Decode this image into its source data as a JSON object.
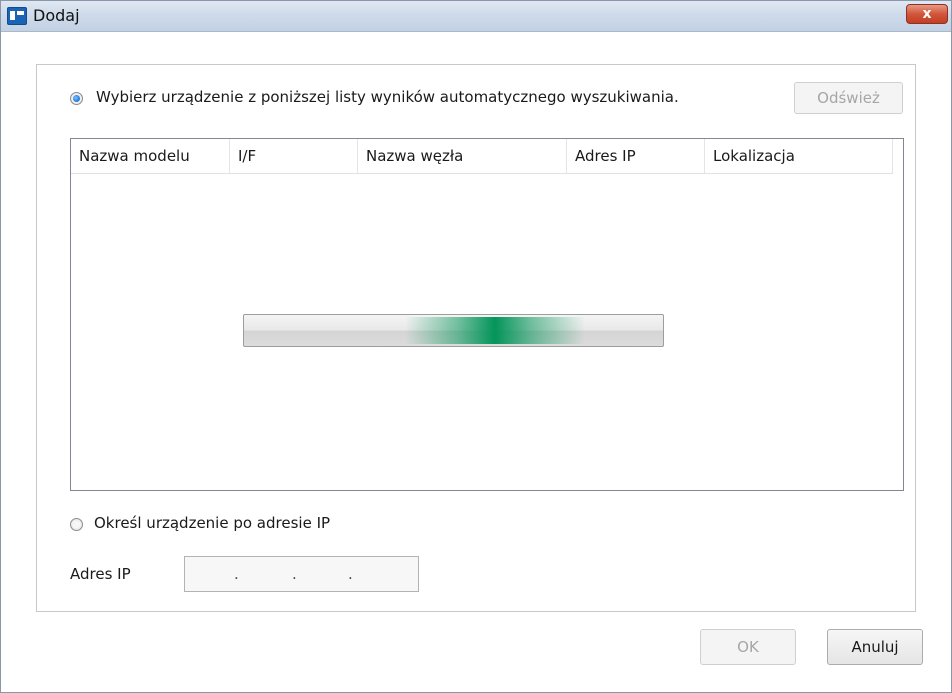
{
  "window": {
    "title": "Dodaj",
    "close_label": "x"
  },
  "auto_search": {
    "radio_label": "Wybierz urządzenie z poniższej listy wyników automatycznego wyszukiwania.",
    "selected": true,
    "refresh_label": "Odśwież",
    "refresh_enabled": false
  },
  "device_list": {
    "columns": [
      "Nazwa modelu",
      "I/F",
      "Nazwa węzła",
      "Adres IP",
      "Lokalizacja"
    ],
    "rows": [],
    "searching_progress": 0.6
  },
  "manual_ip": {
    "radio_label": "Określ urządzenie po adresie IP",
    "selected": false,
    "field_label": "Adres IP",
    "octets": [
      "",
      "",
      "",
      ""
    ],
    "separator": "."
  },
  "footer": {
    "ok_label": "OK",
    "ok_enabled": false,
    "cancel_label": "Anuluj"
  },
  "colors": {
    "progress_accent": "#03955a",
    "close_button": "#c9472e",
    "selected_radio": "#1a73d9"
  }
}
